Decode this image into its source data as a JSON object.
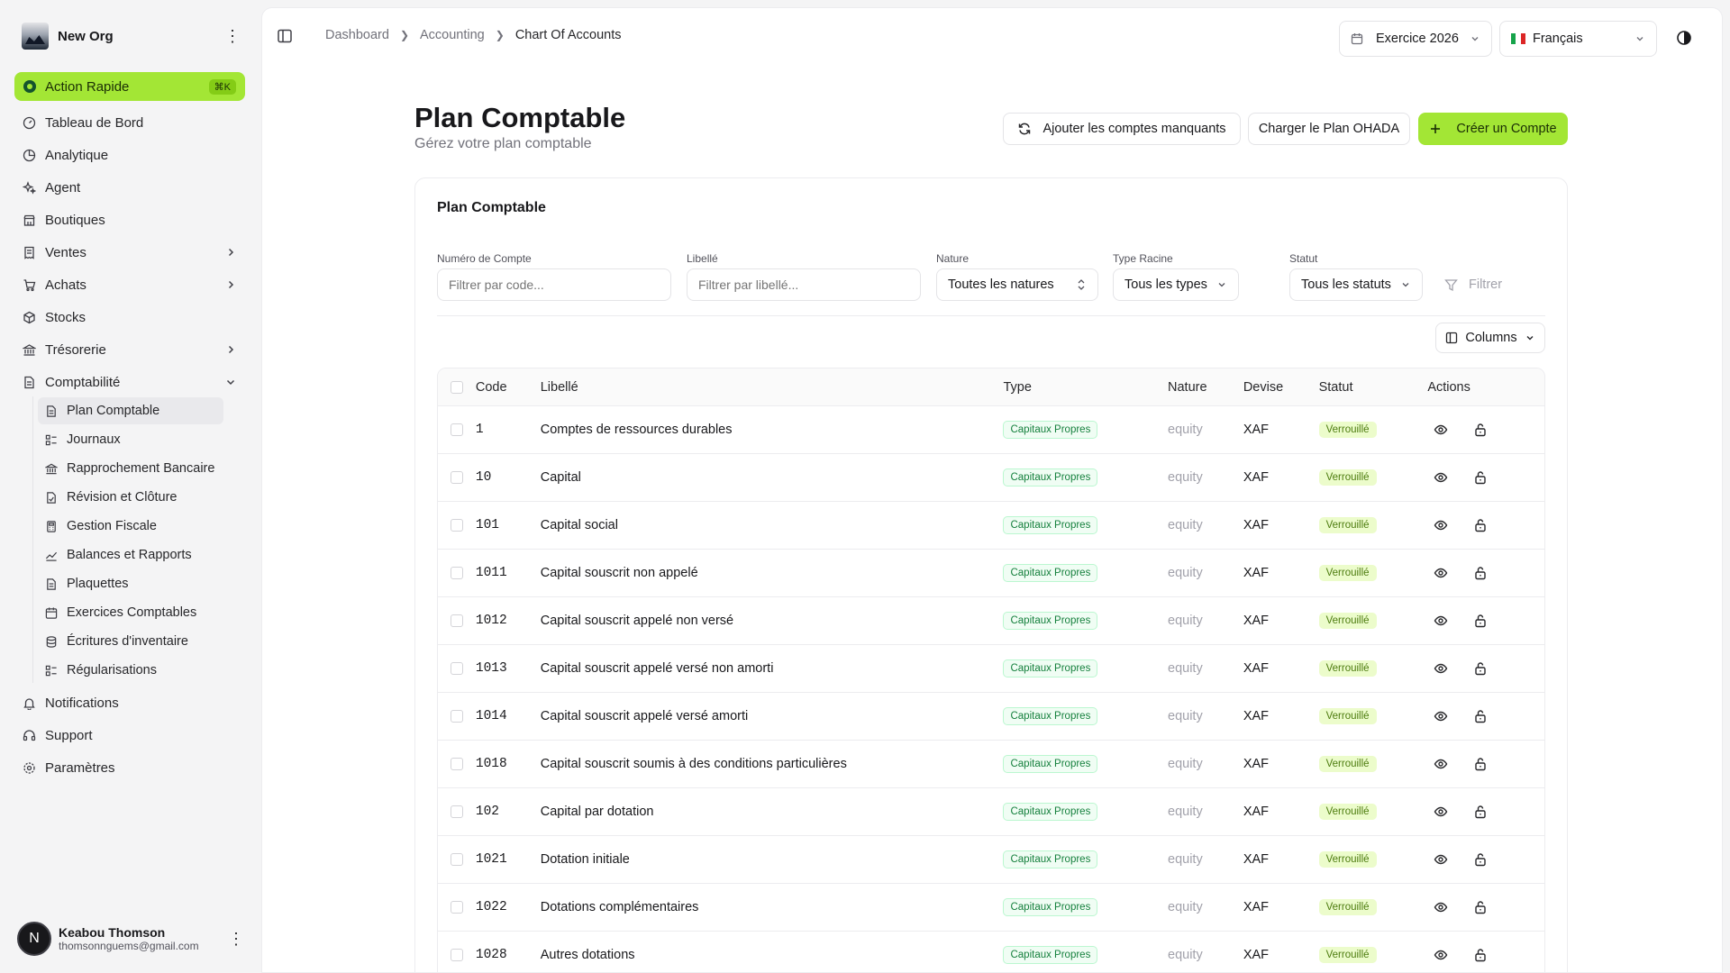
{
  "sidebar": {
    "org_name": "New Org",
    "quick_action": {
      "label": "Action Rapide",
      "shortcut": "⌘K"
    },
    "items": [
      {
        "label": "Tableau de Bord",
        "icon": "gauge-icon"
      },
      {
        "label": "Analytique",
        "icon": "pie-chart-icon"
      },
      {
        "label": "Agent",
        "icon": "sparkles-icon"
      },
      {
        "label": "Boutiques",
        "icon": "store-icon"
      },
      {
        "label": "Ventes",
        "icon": "receipt-icon",
        "chevron": "right"
      },
      {
        "label": "Achats",
        "icon": "cart-icon",
        "chevron": "right"
      },
      {
        "label": "Stocks",
        "icon": "box-icon"
      },
      {
        "label": "Trésorerie",
        "icon": "bank-icon",
        "chevron": "right"
      },
      {
        "label": "Comptabilité",
        "icon": "file-icon",
        "chevron": "down"
      }
    ],
    "subitems": [
      {
        "label": "Plan Comptable",
        "icon": "file-icon",
        "active": true
      },
      {
        "label": "Journaux",
        "icon": "list-icon"
      },
      {
        "label": "Rapprochement Bancaire",
        "icon": "bank-icon"
      },
      {
        "label": "Révision et Clôture",
        "icon": "file-check-icon"
      },
      {
        "label": "Gestion Fiscale",
        "icon": "calculator-icon"
      },
      {
        "label": "Balances et Rapports",
        "icon": "trend-icon"
      },
      {
        "label": "Plaquettes",
        "icon": "file-icon"
      },
      {
        "label": "Exercices Comptables",
        "icon": "calendar-icon"
      },
      {
        "label": "Écritures d'inventaire",
        "icon": "database-icon"
      },
      {
        "label": "Régularisations",
        "icon": "list-icon"
      }
    ],
    "bottom_items": [
      {
        "label": "Notifications",
        "icon": "bell-icon"
      },
      {
        "label": "Support",
        "icon": "headset-icon"
      },
      {
        "label": "Paramètres",
        "icon": "gear-icon"
      }
    ],
    "user": {
      "initial": "N",
      "name": "Keabou Thomson",
      "email": "thomsonnguems@gmail.com"
    }
  },
  "topbar": {
    "breadcrumbs": [
      "Dashboard",
      "Accounting",
      "Chart Of Accounts"
    ],
    "fiscal_year": "Exercice 2026",
    "language": "Français"
  },
  "header": {
    "title": "Plan Comptable",
    "subtitle": "Gérez votre plan comptable",
    "btn_add_missing": "Ajouter les comptes manquants",
    "btn_load_ohada": "Charger le Plan OHADA",
    "btn_create": "Créer un Compte"
  },
  "card": {
    "title": "Plan Comptable",
    "filters": {
      "code_label": "Numéro de Compte",
      "code_placeholder": "Filtrer par code...",
      "lib_label": "Libellé",
      "lib_placeholder": "Filtrer par libellé...",
      "nature_label": "Nature",
      "nature_value": "Toutes les natures",
      "type_label": "Type Racine",
      "type_value": "Tous les types",
      "status_label": "Statut",
      "status_value": "Tous les statuts",
      "filter_btn": "Filtrer"
    },
    "columns_btn": "Columns"
  },
  "table": {
    "headers": {
      "code": "Code",
      "libelle": "Libellé",
      "type": "Type",
      "nature": "Nature",
      "devise": "Devise",
      "statut": "Statut",
      "actions": "Actions"
    },
    "rows": [
      {
        "code": "1",
        "libelle": "Comptes de ressources durables",
        "type": "Capitaux Propres",
        "nature": "equity",
        "devise": "XAF",
        "statut": "Verrouillé"
      },
      {
        "code": "10",
        "libelle": "Capital",
        "type": "Capitaux Propres",
        "nature": "equity",
        "devise": "XAF",
        "statut": "Verrouillé"
      },
      {
        "code": "101",
        "libelle": "Capital social",
        "type": "Capitaux Propres",
        "nature": "equity",
        "devise": "XAF",
        "statut": "Verrouillé"
      },
      {
        "code": "1011",
        "libelle": "Capital souscrit non appelé",
        "type": "Capitaux Propres",
        "nature": "equity",
        "devise": "XAF",
        "statut": "Verrouillé"
      },
      {
        "code": "1012",
        "libelle": "Capital souscrit appelé non versé",
        "type": "Capitaux Propres",
        "nature": "equity",
        "devise": "XAF",
        "statut": "Verrouillé"
      },
      {
        "code": "1013",
        "libelle": "Capital souscrit appelé versé non amorti",
        "type": "Capitaux Propres",
        "nature": "equity",
        "devise": "XAF",
        "statut": "Verrouillé"
      },
      {
        "code": "1014",
        "libelle": "Capital souscrit appelé versé amorti",
        "type": "Capitaux Propres",
        "nature": "equity",
        "devise": "XAF",
        "statut": "Verrouillé"
      },
      {
        "code": "1018",
        "libelle": "Capital souscrit soumis à des conditions particulières",
        "type": "Capitaux Propres",
        "nature": "equity",
        "devise": "XAF",
        "statut": "Verrouillé"
      },
      {
        "code": "102",
        "libelle": "Capital par dotation",
        "type": "Capitaux Propres",
        "nature": "equity",
        "devise": "XAF",
        "statut": "Verrouillé"
      },
      {
        "code": "1021",
        "libelle": "Dotation initiale",
        "type": "Capitaux Propres",
        "nature": "equity",
        "devise": "XAF",
        "statut": "Verrouillé"
      },
      {
        "code": "1022",
        "libelle": "Dotations complémentaires",
        "type": "Capitaux Propres",
        "nature": "equity",
        "devise": "XAF",
        "statut": "Verrouillé"
      },
      {
        "code": "1028",
        "libelle": "Autres dotations",
        "type": "Capitaux Propres",
        "nature": "equity",
        "devise": "XAF",
        "statut": "Verrouillé"
      }
    ]
  },
  "colors": {
    "accent": "#a3e635",
    "badge_green": "#15803d"
  }
}
